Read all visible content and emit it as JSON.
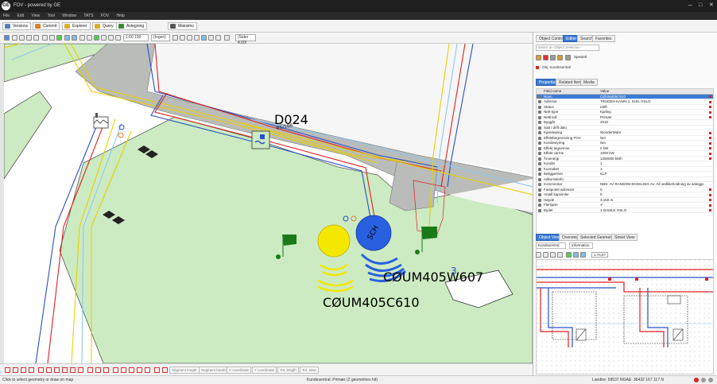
{
  "app": {
    "title": "FOV - powered by GE"
  },
  "menu": [
    "File",
    "Edit",
    "View",
    "Tool",
    "Window",
    "TATS",
    "FOV",
    "Help"
  ],
  "toolbar1": [
    {
      "label": "Versions",
      "color": "#5a7fb5"
    },
    {
      "label": "Commit",
      "color": "#d9822b"
    },
    {
      "label": "Explorer",
      "color": "#d9b02b"
    },
    {
      "label": "Query",
      "color": "#d9b02b"
    },
    {
      "label": "Avtegning",
      "color": "#3a8a3a"
    },
    {
      "label": "Maksimo",
      "color": "#555555"
    }
  ],
  "toolbar2": {
    "scale": "1:60 150",
    "layer": "(Ingen)",
    "srid": "(Sider 4.00)"
  },
  "map": {
    "label_d024": "D024",
    "label_parcel": "65/106",
    "label_c607": "CØUM405W607",
    "label_c610": "CØUM405C610",
    "label_sch": "SCH",
    "label_3": "3"
  },
  "bottom_buttons": [
    "Segment length",
    "Segment bearing",
    "X coordinate",
    "Y coordinate",
    "Tot. length",
    "Tot. area"
  ],
  "status": {
    "left": "Click to select geometry or draw on map",
    "center": "Kundesentral: Primær (2 geometries hit)",
    "right": "Landtre: 59537 NGAE: 36432 167 117 N"
  },
  "panel": {
    "tabs": [
      "Object Control",
      "Editor",
      "Search",
      "Favorites"
    ],
    "active_tab": "Editor",
    "dropdown_placeholder": "Select an Object Selection",
    "spec_label": "Spesielt",
    "object_label": "Obj: Kundesentral",
    "subtabs": [
      "Properties",
      "Related Items",
      "Media"
    ],
    "active_subtab": "Properties",
    "columns": [
      "Field name",
      "Value"
    ],
    "properties": [
      {
        "name": "Navn",
        "value": "CØUM405C610",
        "req": true,
        "sel": true
      },
      {
        "name": "Adresse",
        "value": "TRUDEN KASIN 1, 0191 OSLO",
        "req": true
      },
      {
        "name": "Status",
        "value": "Idrift",
        "req": true
      },
      {
        "name": "Nett-type",
        "value": "Kjøling",
        "req": true
      },
      {
        "name": "Nettnivå",
        "value": "Primær",
        "req": true
      },
      {
        "name": "Byggår",
        "value": "2010",
        "req": false
      },
      {
        "name": "Satt i drift dato",
        "value": "",
        "req": false
      },
      {
        "name": "Kjøretøying",
        "value": "WonderWare",
        "req": true
      },
      {
        "name": "Effektbegrensning FOV",
        "value": "Nei",
        "req": true
      },
      {
        "name": "Kundestyring",
        "value": "Nei",
        "req": true
      },
      {
        "name": "Effekt tegnemne",
        "value": "0 kW",
        "req": true
      },
      {
        "name": "Effekt varme",
        "value": "1000 kW",
        "req": true
      },
      {
        "name": "Årsenergi",
        "value": "1250000 kWh",
        "req": true
      },
      {
        "name": "Kunder",
        "value": "1",
        "req": false
      },
      {
        "name": "Kunnaber",
        "value": "1",
        "req": false
      },
      {
        "name": "Beliggenhet",
        "value": "KLP",
        "req": false
      },
      {
        "name": "Adkomstinfo",
        "value": "",
        "req": false
      },
      {
        "name": "Kommentar",
        "value": "NBS: AV RANSOM EKSKLING AV. All vedlikeholdning av anlegget / FO...",
        "req": false
      },
      {
        "name": "Fastpunkt adresser",
        "value": "0",
        "req": true
      },
      {
        "name": "Antall kapsimler",
        "value": "0",
        "req": true
      },
      {
        "name": "Høyde",
        "value": "3,150 m",
        "req": true
      },
      {
        "name": "Flerkjøre",
        "value": "✔",
        "req": true
      },
      {
        "name": "Bydel",
        "value": "1 GAMLE OSLO",
        "req": true
      }
    ],
    "lower_tabs": [
      "Object View",
      "Overview",
      "Selected Geometries",
      "Street View"
    ],
    "active_lower_tab": "Object View",
    "lower_select": "Kundesentral",
    "lower_select2": "Information",
    "lower_scale": "1:74,5?"
  },
  "colors": {
    "accent": "#3a7bd5",
    "titlebar": "#1e1e1e",
    "map_green": "#ccebc2",
    "road_grey": "#b9bcb8"
  }
}
